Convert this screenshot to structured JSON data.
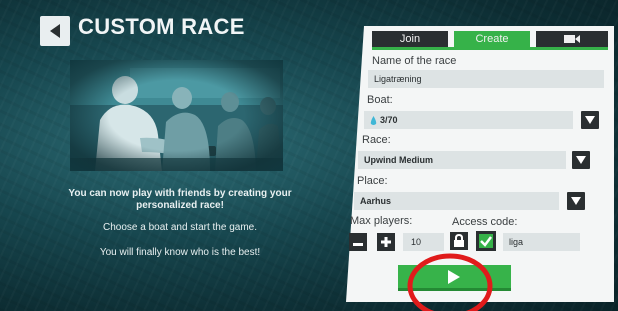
{
  "header": {
    "title": "CUSTOM RACE"
  },
  "info": {
    "line1": "You can now play with friends by creating your personalized race!",
    "line2": "Choose a boat and start the game.",
    "line3": "You will finally know who is the best!"
  },
  "tabs": {
    "join": "Join",
    "create": "Create",
    "active": "Create"
  },
  "form": {
    "name_label": "Name of the race",
    "name_value": "Ligatræning",
    "boat_label": "Boat:",
    "boat_value": "3/70",
    "race_label": "Race:",
    "race_value": "Upwind Medium",
    "place_label": "Place:",
    "place_value": "Aarhus",
    "max_players_label": "Max players:",
    "max_players_value": "10",
    "access_code_label": "Access code:",
    "access_code_value": "liga",
    "access_code_enabled": true
  },
  "colors": {
    "accent": "#36b249",
    "dark_button": "#2a2f31",
    "highlight_ring": "#e01b1b"
  }
}
